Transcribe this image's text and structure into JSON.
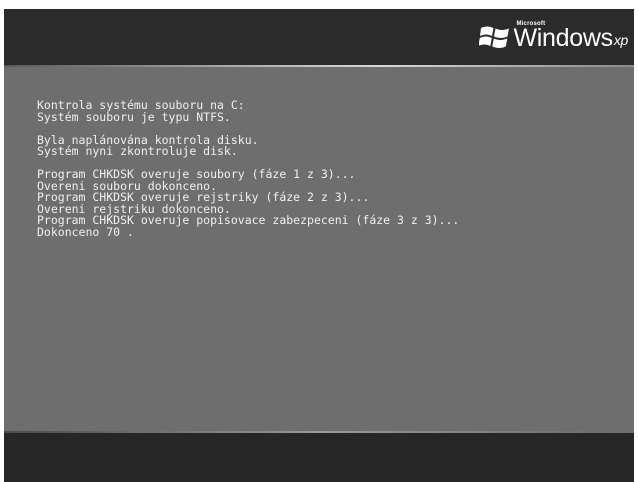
{
  "logo": {
    "microsoft": "Microsoft",
    "windows": "Windows",
    "edition": "xp"
  },
  "console": {
    "blocks": [
      [
        "Kontrola systému souboru na C:",
        "Systém souboru je typu NTFS."
      ],
      [
        "Byla naplánována kontrola disku.",
        "Systém nyni zkontroluje disk."
      ],
      [
        "Program CHKDSK overuje soubory (fáze 1 z 3)...",
        "Overeni souboru dokonceno.",
        "Program CHKDSK overuje rejstriky (fáze 2 z 3)...",
        "Overeni rejstriku dokonceno.",
        "Program CHKDSK overuje popisovace zabezpeceni (fáze 3 z 3)...",
        "Dokonceno 70 ."
      ]
    ]
  },
  "colors": {
    "panel": "#6e6e6e",
    "bars": "#262626",
    "text": "#f0f0f0"
  }
}
